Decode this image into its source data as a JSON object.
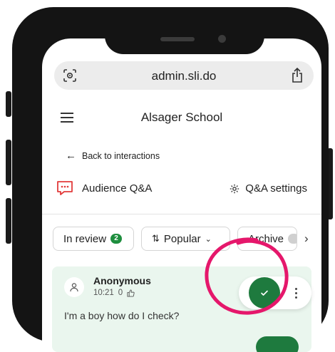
{
  "browser": {
    "url": "admin.sli.do",
    "left_icon": "camera-scan-icon",
    "right_icon": "share-icon"
  },
  "header": {
    "menu_icon": "hamburger-menu-icon",
    "title": "Alsager School"
  },
  "nav": {
    "back_label": "Back to interactions",
    "back_icon": "arrow-left-icon"
  },
  "section": {
    "title": "Audience Q&A",
    "title_icon": "chat-bubble-icon",
    "settings_label": "Q&A settings",
    "settings_icon": "gear-icon"
  },
  "filters": {
    "in_review_label": "In review",
    "in_review_count": "2",
    "sort_label": "Popular",
    "archive_label": "Archive",
    "next_icon": "chevron-right-icon"
  },
  "question": {
    "author": "Anonymous",
    "time": "10:21",
    "likes": "0",
    "text": "I'm a boy how do I check?",
    "approve_icon": "check-icon",
    "more_icon": "more-vertical-icon"
  },
  "colors": {
    "accent_green": "#1e7a3e",
    "badge_green": "#1e8e3e",
    "card_bg": "#eaf6ee",
    "annotation": "#e5176b",
    "brand_red": "#e23b3b"
  }
}
